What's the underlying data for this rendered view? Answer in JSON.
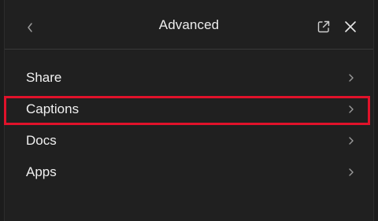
{
  "header": {
    "title": "Advanced",
    "back_icon": "chevron-left-icon",
    "popout_icon": "open-in-new-window-icon",
    "close_icon": "close-icon"
  },
  "menu": {
    "items": [
      {
        "label": "Share",
        "icon": "chevron-right-icon",
        "highlighted": false
      },
      {
        "label": "Captions",
        "icon": "chevron-right-icon",
        "highlighted": true
      },
      {
        "label": "Docs",
        "icon": "chevron-right-icon",
        "highlighted": false
      },
      {
        "label": "Apps",
        "icon": "chevron-right-icon",
        "highlighted": false
      }
    ]
  },
  "colors": {
    "background": "#202020",
    "text": "#f0f0f0",
    "muted_icon": "#9a9a9a",
    "highlight_border": "#e0122a"
  }
}
